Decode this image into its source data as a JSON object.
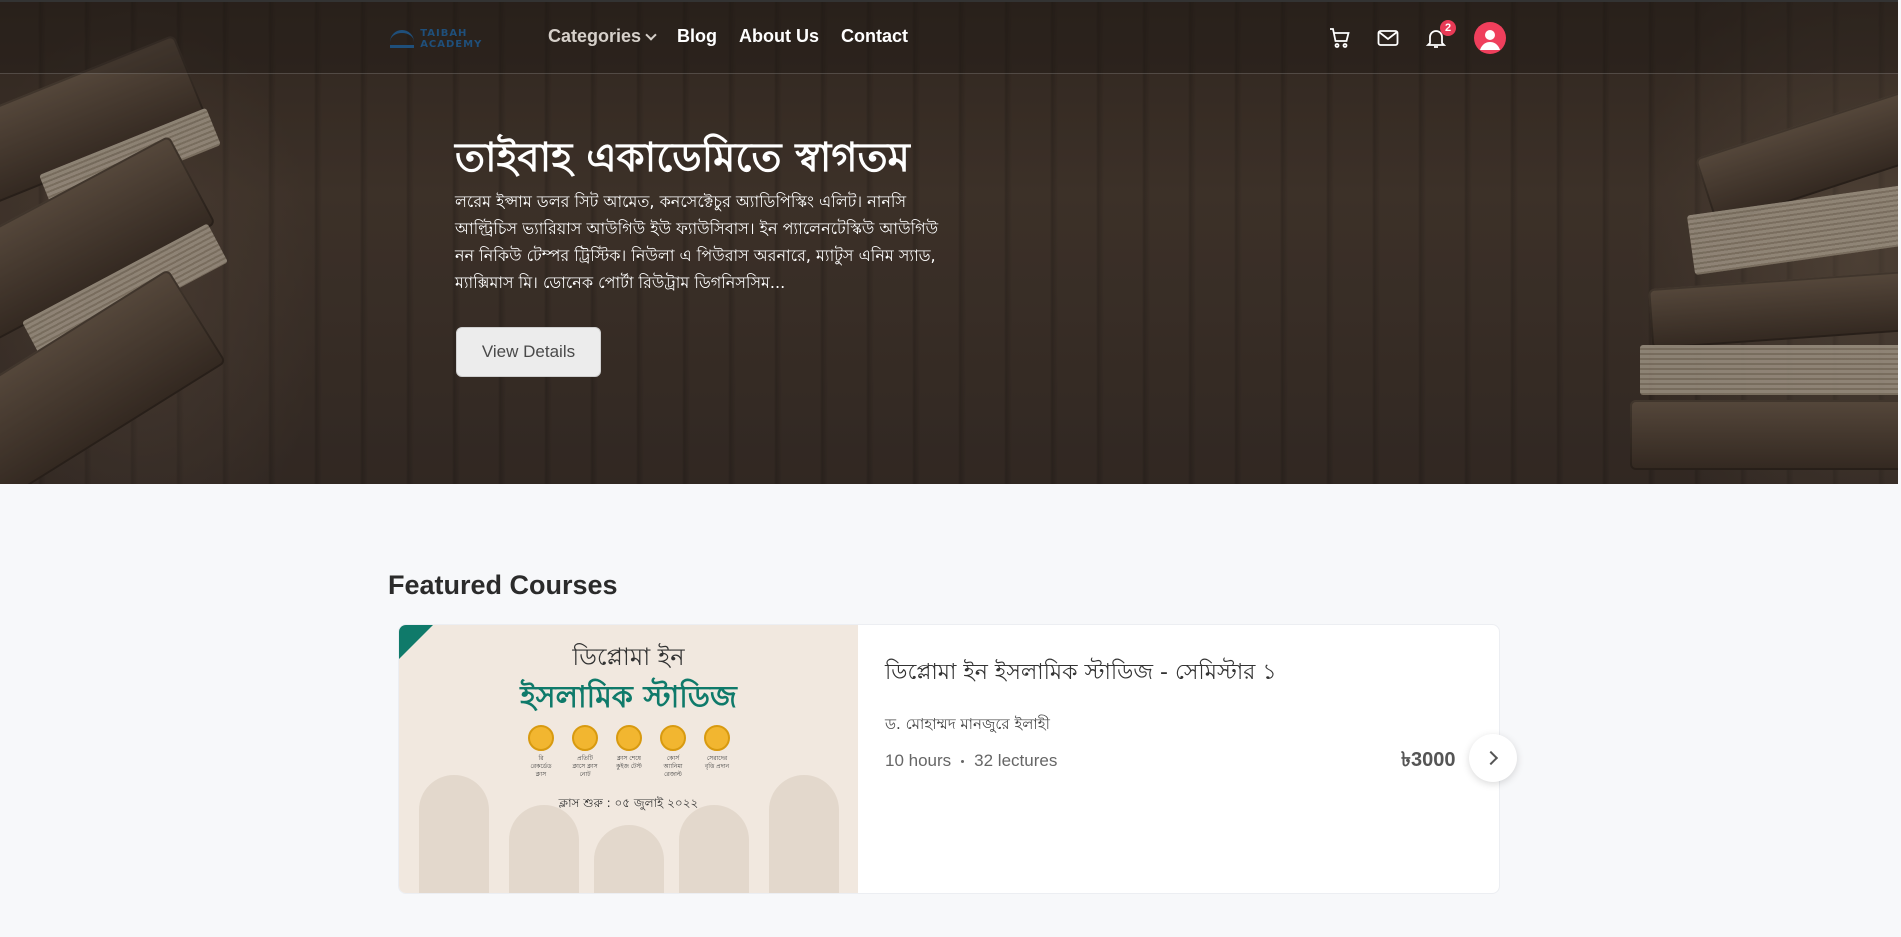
{
  "nav": {
    "logo_text": "TAIBAH ACADEMY",
    "links": [
      {
        "label": "Categories"
      },
      {
        "label": "Blog"
      },
      {
        "label": "About Us"
      },
      {
        "label": "Contact"
      }
    ],
    "notification_count": "2"
  },
  "hero": {
    "title": "তাইবাহ একাডেমিতে স্বাগতম",
    "text": "লরেম ইপ্সাম ডলর সিট আমেত, কনসেক্টেচুর অ্যাডিপিস্কিং এলিট। নানসি আল্ট্রিচিস ভ্যারিয়াস আউগিউ ইউ ফ্যাউসিবাস। ইন প্যালেনটেস্কিউ আউগিউ নন নিকিউ টেম্পর ট্রিস্টিক। নিউলা এ পিউরাস অরনারে, ম্যাটুস এনিম স্যাড, ম্যাক্সিমাস মি। ডোনেক পোর্টা রিউট্রাম ডিগনিসসিম...",
    "button_label": "View Details"
  },
  "featured": {
    "title": "Featured Courses",
    "course": {
      "thumb_top": "ডিপ্লোমা ইন",
      "thumb_main": "ইসলামিক স্টাডিজ",
      "thumb_features": [
        "রি রেকর্ডেড ক্লাস",
        "প্রতিটি ক্লাসে ক্লাস নোট",
        "ক্লাস শেষে কুইজ টেস্ট",
        "কোর্স অ্যানিমা রেজাল্ট",
        "সেরাদের বৃত্তি প্রদান"
      ],
      "thumb_date": "ক্লাস শুরু : ০৫ জুলাই ২০২২",
      "title": "ডিপ্লোমা ইন ইসলামিক স্টাডিজ - সেমিস্টার ১",
      "author": "ড. মোহাম্মদ মানজুরে ইলাহী",
      "hours": "10 hours",
      "lectures": "32 lectures",
      "price": "৳3000"
    }
  },
  "colors": {
    "accent": "#0f7a6a",
    "badge": "#e83a56",
    "avatar": "#ef3f5c"
  }
}
